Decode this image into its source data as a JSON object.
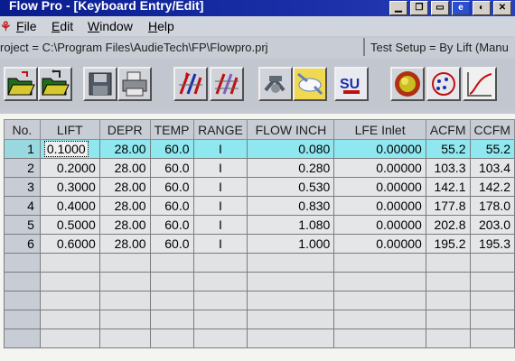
{
  "window": {
    "title": "Flow Pro - [Keyboard Entry/Edit]"
  },
  "menu": {
    "items": [
      {
        "label": "File",
        "accel": "F",
        "rest": "ile"
      },
      {
        "label": "Edit",
        "accel": "E",
        "rest": "dit"
      },
      {
        "label": "Window",
        "accel": "W",
        "rest": "indow"
      },
      {
        "label": "Help",
        "accel": "H",
        "rest": "elp"
      }
    ]
  },
  "pathbar": {
    "project": "roject = C:\\Program Files\\AudieTech\\FP\\Flowpro.prj",
    "test_setup": "Test Setup = By Lift (Manu"
  },
  "toolbar": {
    "buttons": [
      {
        "icon": "open-folder-icon"
      },
      {
        "icon": "save-folder-icon"
      },
      {
        "icon": "disk-icon"
      },
      {
        "icon": "printer-icon"
      },
      {
        "icon": "flow-arrows-icon"
      },
      {
        "icon": "flow-arrows-alt-icon"
      },
      {
        "icon": "gear-arrows-icon"
      },
      {
        "icon": "cloud-icon"
      },
      {
        "icon": "su-magnet-icon"
      },
      {
        "icon": "sphere-icon"
      },
      {
        "icon": "scatter-plot-icon"
      },
      {
        "icon": "curve-plot-icon"
      }
    ]
  },
  "grid": {
    "headers": [
      "No.",
      "LIFT",
      "DEPR",
      "TEMP",
      "RANGE",
      "FLOW INCH",
      "LFE Inlet",
      "ACFM",
      "CCFM"
    ],
    "rows": [
      {
        "no": "1",
        "lift": "0.1000",
        "depr": "28.00",
        "temp": "60.0",
        "range": "I",
        "flow": "0.080",
        "lfe": "0.00000",
        "acfm": "55.2",
        "ccfm": "55.2"
      },
      {
        "no": "2",
        "lift": "0.2000",
        "depr": "28.00",
        "temp": "60.0",
        "range": "I",
        "flow": "0.280",
        "lfe": "0.00000",
        "acfm": "103.3",
        "ccfm": "103.4"
      },
      {
        "no": "3",
        "lift": "0.3000",
        "depr": "28.00",
        "temp": "60.0",
        "range": "I",
        "flow": "0.530",
        "lfe": "0.00000",
        "acfm": "142.1",
        "ccfm": "142.2"
      },
      {
        "no": "4",
        "lift": "0.4000",
        "depr": "28.00",
        "temp": "60.0",
        "range": "I",
        "flow": "0.830",
        "lfe": "0.00000",
        "acfm": "177.8",
        "ccfm": "178.0"
      },
      {
        "no": "5",
        "lift": "0.5000",
        "depr": "28.00",
        "temp": "60.0",
        "range": "I",
        "flow": "1.080",
        "lfe": "0.00000",
        "acfm": "202.8",
        "ccfm": "203.0"
      },
      {
        "no": "6",
        "lift": "0.6000",
        "depr": "28.00",
        "temp": "60.0",
        "range": "I",
        "flow": "1.000",
        "lfe": "0.00000",
        "acfm": "195.2",
        "ccfm": "195.3"
      }
    ],
    "selected_row": 1
  },
  "colors": {
    "titlebar": "#0a1d8f",
    "selected_row": "#8fe8f0",
    "grid_bg": "#e4e6e8"
  }
}
